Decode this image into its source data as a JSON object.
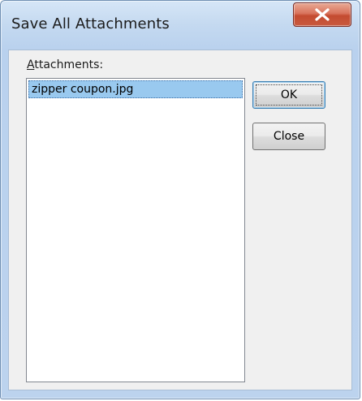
{
  "window": {
    "title": "Save All Attachments",
    "close_glyph": "X"
  },
  "attachments": {
    "label_accel": "A",
    "label_rest": "ttachments:",
    "items": [
      {
        "label": "zipper coupon.jpg",
        "selected": true
      }
    ]
  },
  "buttons": {
    "ok_label": "OK",
    "close_label": "Close"
  },
  "colors": {
    "selection": "#99c9ef",
    "close_button": "#c44b30",
    "dialog_face": "#f0f0f0"
  }
}
